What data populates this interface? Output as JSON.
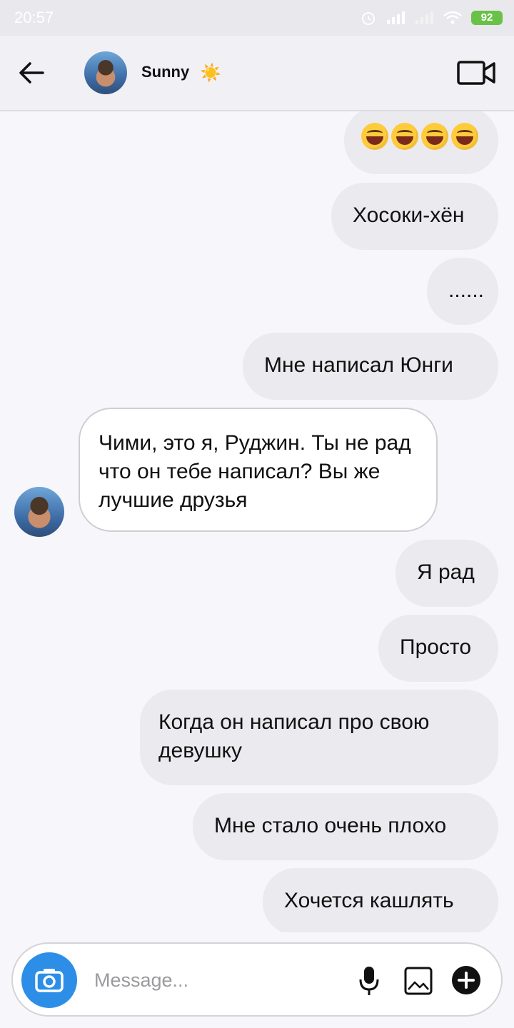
{
  "status_bar": {
    "time": "20:57",
    "battery": "92"
  },
  "header": {
    "contact_name": "Sunny",
    "name_emoji": "☀️"
  },
  "messages": [
    {
      "id": "emoji",
      "direction": "out",
      "text": ""
    },
    {
      "id": "m1",
      "direction": "out",
      "text": "Хосоки-хён"
    },
    {
      "id": "m2",
      "direction": "out",
      "text": "......"
    },
    {
      "id": "m3",
      "direction": "out",
      "text": "Мне написал Юнги"
    },
    {
      "id": "m4",
      "direction": "in",
      "text": "Чими, это я, Руджин. Ты не рад что он тебе написал? Вы же лучшие друзья"
    },
    {
      "id": "m5",
      "direction": "out",
      "text": "Я рад"
    },
    {
      "id": "m6",
      "direction": "out",
      "text": "Просто"
    },
    {
      "id": "m7",
      "direction": "out",
      "text": "Когда он написал про свою девушку"
    },
    {
      "id": "m8",
      "direction": "out",
      "text": "Мне стало очень плохо"
    },
    {
      "id": "m9",
      "direction": "out",
      "text": "Хочется кашлять"
    }
  ],
  "composer": {
    "placeholder": "Message..."
  },
  "icons": {
    "back": "arrow-left-icon",
    "video": "video-camera-icon",
    "camera": "camera-icon",
    "mic": "microphone-icon",
    "gallery": "image-icon",
    "plus": "plus-circle-icon"
  },
  "colors": {
    "bubble_out": "#ebeaee",
    "bubble_in": "#ffffff",
    "camera_button": "#2d8ee8",
    "battery": "#69c247"
  }
}
